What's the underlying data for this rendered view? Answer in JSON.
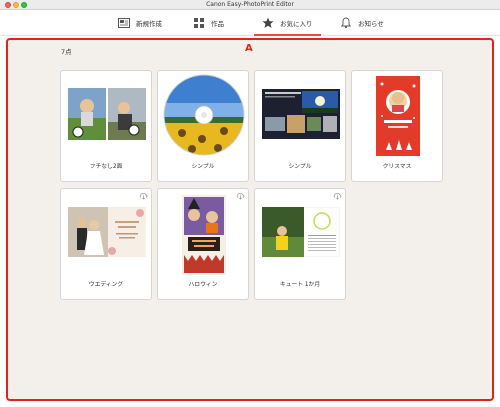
{
  "window": {
    "title": "Canon Easy-PhotoPrint Editor"
  },
  "nav": [
    {
      "label": "新規作成",
      "icon": "new-creation-icon",
      "active": false
    },
    {
      "label": "作品",
      "icon": "grid-icon",
      "active": false
    },
    {
      "label": "お気に入り",
      "icon": "star-icon",
      "active": true
    },
    {
      "label": "お知らせ",
      "icon": "bell-icon",
      "active": false
    }
  ],
  "content": {
    "count": "7点",
    "callout": "A",
    "items": [
      {
        "label": "フチなし2面",
        "icon": ""
      },
      {
        "label": "シンプル",
        "icon": ""
      },
      {
        "label": "シンプル",
        "icon": ""
      },
      {
        "label": "クリスマス",
        "icon": ""
      },
      {
        "label": "ウエディング",
        "icon": "cloud-download-icon"
      },
      {
        "label": "ハロウィン",
        "icon": "cloud-download-icon"
      },
      {
        "label": "キュート 1か月",
        "icon": "cloud-download-icon"
      }
    ]
  },
  "colors": {
    "accent": "#e2231a",
    "tab_underline": "#e84a3b",
    "content_bg": "#f3f0eb"
  }
}
